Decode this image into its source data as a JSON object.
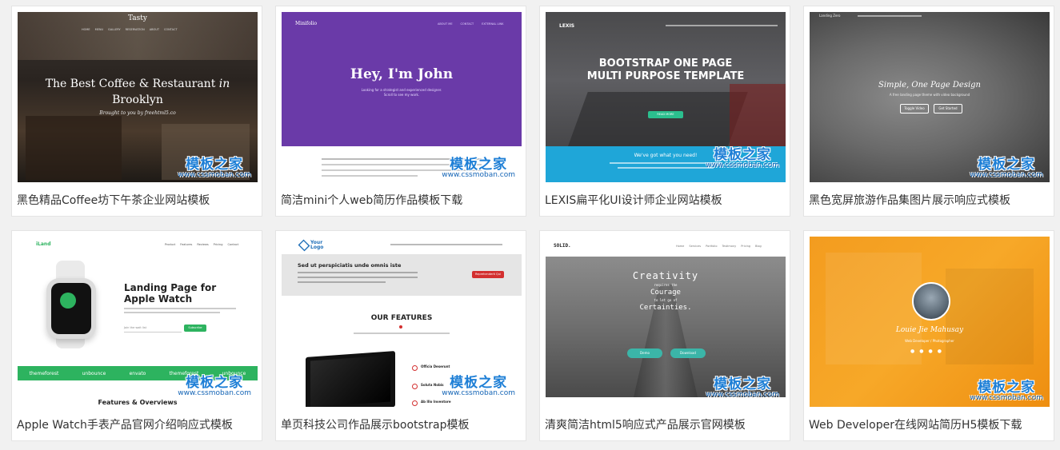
{
  "watermark": {
    "cn": "模板之家",
    "en": "www.cssmoban.com"
  },
  "cards": [
    {
      "title": "黑色精品Coffee坊下午茶企业网站模板",
      "preview": {
        "brand": "Tasty",
        "headline_1": "The Best Coffee & Restaurant",
        "headline_in": "in",
        "headline_2": "Brooklyn",
        "sub": "Brought to you by freehtml5.co",
        "nav": [
          "HOME",
          "MENU",
          "GALLERY",
          "RESERVATION",
          "ABOUT",
          "CONTACT"
        ]
      }
    },
    {
      "title": "简洁mini个人web简历作品模板下载",
      "preview": {
        "brand": "Minifolio",
        "headline": "Hey, I'm John",
        "sub": "Looking for a strategist and experienced designer. Scroll to see my work.",
        "nav": [
          "ABOUT ME",
          "CONTACT",
          "EXTERNAL LINK"
        ]
      }
    },
    {
      "title": "LEXIS扁平化UI设计师企业网站模板",
      "preview": {
        "brand": "LEXIS",
        "headline_1": "BOOTSTRAP ONE PAGE",
        "headline_2": "MULTI PURPOSE TEMPLATE",
        "button": "READ MORE",
        "band": "We've got what you need!"
      }
    },
    {
      "title": "黑色宽屏旅游作品集图片展示响应式模板",
      "preview": {
        "brand": "Landing Zero",
        "headline": "Simple, One Page Design",
        "sub": "A free landing page theme with video background",
        "btn_1": "Toggle Video",
        "btn_2": "Get Started"
      }
    },
    {
      "title": "Apple Watch手表产品官网介绍响应式模板",
      "preview": {
        "brand": "iLand",
        "headline": "Landing Page for Apple Watch",
        "button": "Subscribe",
        "placeholder": "Join the wait list",
        "nav": [
          "Product",
          "Features",
          "Reviews",
          "Pricing",
          "Contact"
        ],
        "logos": [
          "themeforest",
          "unbounce",
          "envato",
          "themeforest",
          "unbounce"
        ],
        "features": "Features & Overviews"
      }
    },
    {
      "title": "单页科技公司作品展示bootstrap模板",
      "preview": {
        "brand": "Your Logo",
        "headline": "Sed ut perspiciatis unde omnis iste",
        "button": "Reprehenderit Qui",
        "section": "OUR FEATURES",
        "items": [
          "Officia Deserunt",
          "Soluta Nobis",
          "Ab Illo Inventore"
        ]
      }
    },
    {
      "title": "清爽简洁html5响应式产品展示官网模板",
      "preview": {
        "brand": "SOLID.",
        "line_1": "Creativity",
        "line_2": "requires the",
        "line_3": "Courage",
        "line_4": "to let go of",
        "line_5": "Certainties.",
        "btn_1": "Demo",
        "btn_2": "Download",
        "nav": [
          "Home",
          "Services",
          "Portfolio",
          "Testimony",
          "Pricing",
          "Blog"
        ]
      }
    },
    {
      "title": "Web Developer在线网站简历H5模板下载",
      "preview": {
        "name": "Louie Jie Mahusay",
        "sub": "Web Developer / Photographer"
      }
    }
  ]
}
